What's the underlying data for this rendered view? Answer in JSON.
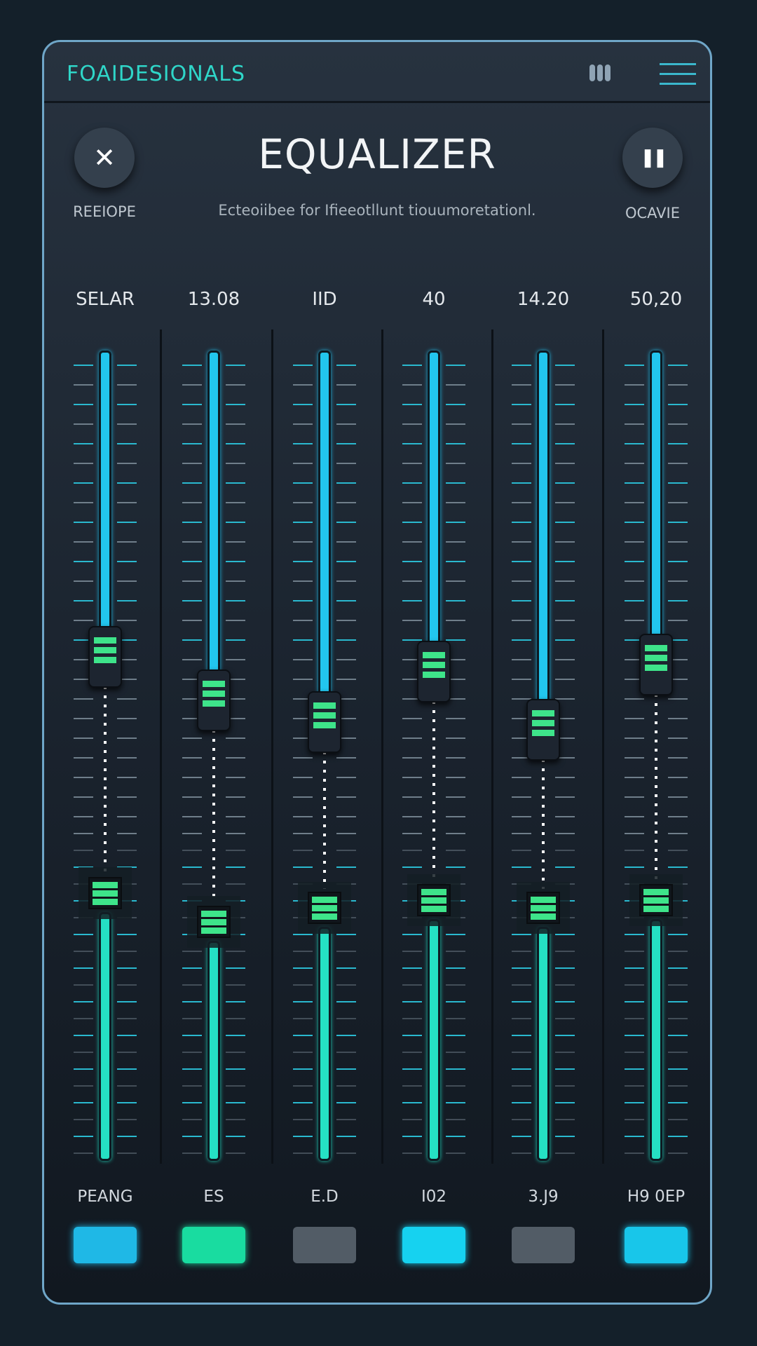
{
  "header": {
    "brand": "FOAIDESIONALS"
  },
  "title": "EQUALIZER",
  "subtitle": "Ecteoiibee for Ifieeotllunt tiouumoretationl.",
  "left_button": {
    "icon": "close-icon",
    "glyph": "✕",
    "label": "REEIOPE"
  },
  "right_button": {
    "icon": "pause-icon",
    "glyph": "❚❚",
    "label": "OCAVIE"
  },
  "channels": [
    {
      "value": "SELAR",
      "upper_level": 0.62,
      "lower_level": 0.4,
      "button_label": "PEANG",
      "button_color": "#1fb8e6"
    },
    {
      "value": "13.08",
      "upper_level": 0.56,
      "lower_level": 0.36,
      "button_label": "ES",
      "button_color": "#19dca0"
    },
    {
      "value": "IID",
      "upper_level": 0.53,
      "lower_level": 0.38,
      "button_label": "E.D",
      "button_color": "#525c66"
    },
    {
      "value": "40",
      "upper_level": 0.6,
      "lower_level": 0.39,
      "button_label": "I02",
      "button_color": "#16d2f0"
    },
    {
      "value": "14.20",
      "upper_level": 0.52,
      "lower_level": 0.38,
      "button_label": "3.J9",
      "button_color": "#525c66"
    },
    {
      "value": "50,20",
      "upper_level": 0.61,
      "lower_level": 0.39,
      "button_label": "H9 0EP",
      "button_color": "#18c6ea"
    }
  ]
}
